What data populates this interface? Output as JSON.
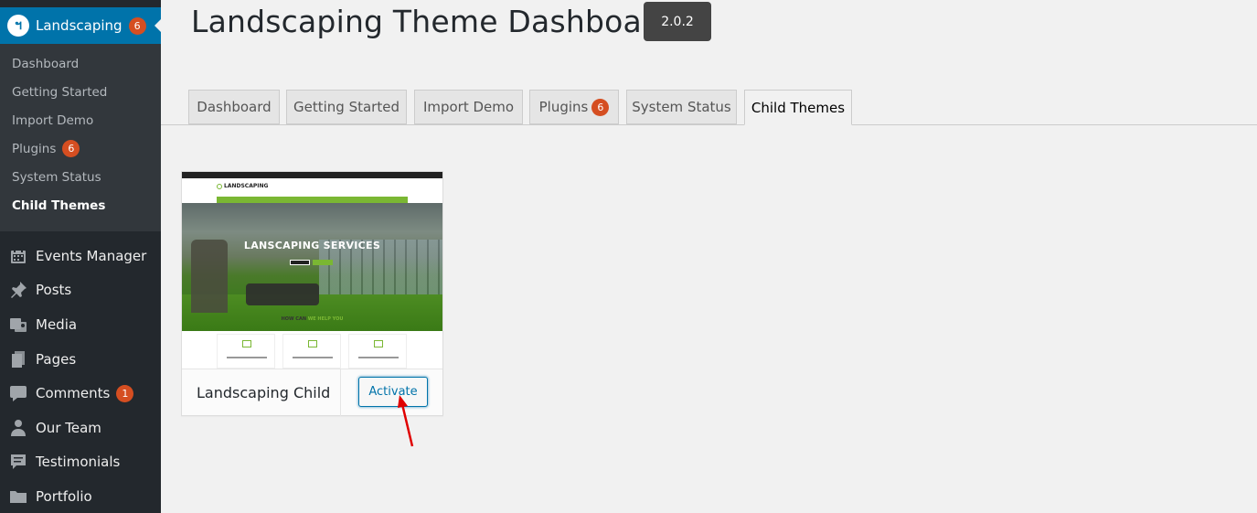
{
  "sidebar": {
    "active_menu": {
      "title": "Landscaping",
      "badge": "6",
      "logo_icon": "landscaping-logo-icon",
      "accent": "#0073aa"
    },
    "submenu": [
      {
        "label": "Dashboard"
      },
      {
        "label": "Getting Started"
      },
      {
        "label": "Import Demo"
      },
      {
        "label": "Plugins",
        "badge": "6"
      },
      {
        "label": "System Status"
      },
      {
        "label": "Child Themes",
        "current": true
      }
    ],
    "menu": [
      {
        "label": "Events Manager",
        "icon": "calendar-icon"
      },
      {
        "label": "Posts",
        "icon": "pin-icon"
      },
      {
        "label": "Media",
        "icon": "media-icon"
      },
      {
        "label": "Pages",
        "icon": "pages-icon"
      },
      {
        "label": "Comments",
        "icon": "comment-icon",
        "badge": "1"
      },
      {
        "label": "Our Team",
        "icon": "person-icon"
      },
      {
        "label": "Testimonials",
        "icon": "testimonial-icon"
      },
      {
        "label": "Portfolio",
        "icon": "folder-icon"
      }
    ]
  },
  "header": {
    "title": "Landscaping Theme Dashboard",
    "version": "2.0.2"
  },
  "tabs": [
    {
      "label": "Dashboard"
    },
    {
      "label": "Getting Started"
    },
    {
      "label": "Import Demo"
    },
    {
      "label": "Plugins",
      "badge": "6"
    },
    {
      "label": "System Status"
    },
    {
      "label": "Child Themes",
      "active": true
    }
  ],
  "theme_card": {
    "name": "Landscaping Child",
    "activate_label": "Activate",
    "screenshot": {
      "logo": "LANDSCAPING",
      "hero_title": "LANSCAPING SERVICES",
      "section_title_prefix": "HOW CAN ",
      "section_title_accent": "WE HELP YOU",
      "brand_green": "#7ab733"
    }
  },
  "colors": {
    "badge": "#d54e21",
    "sidebar_bg": "#23282d",
    "submenu_bg": "#32373c",
    "arrow": "#e00000"
  }
}
